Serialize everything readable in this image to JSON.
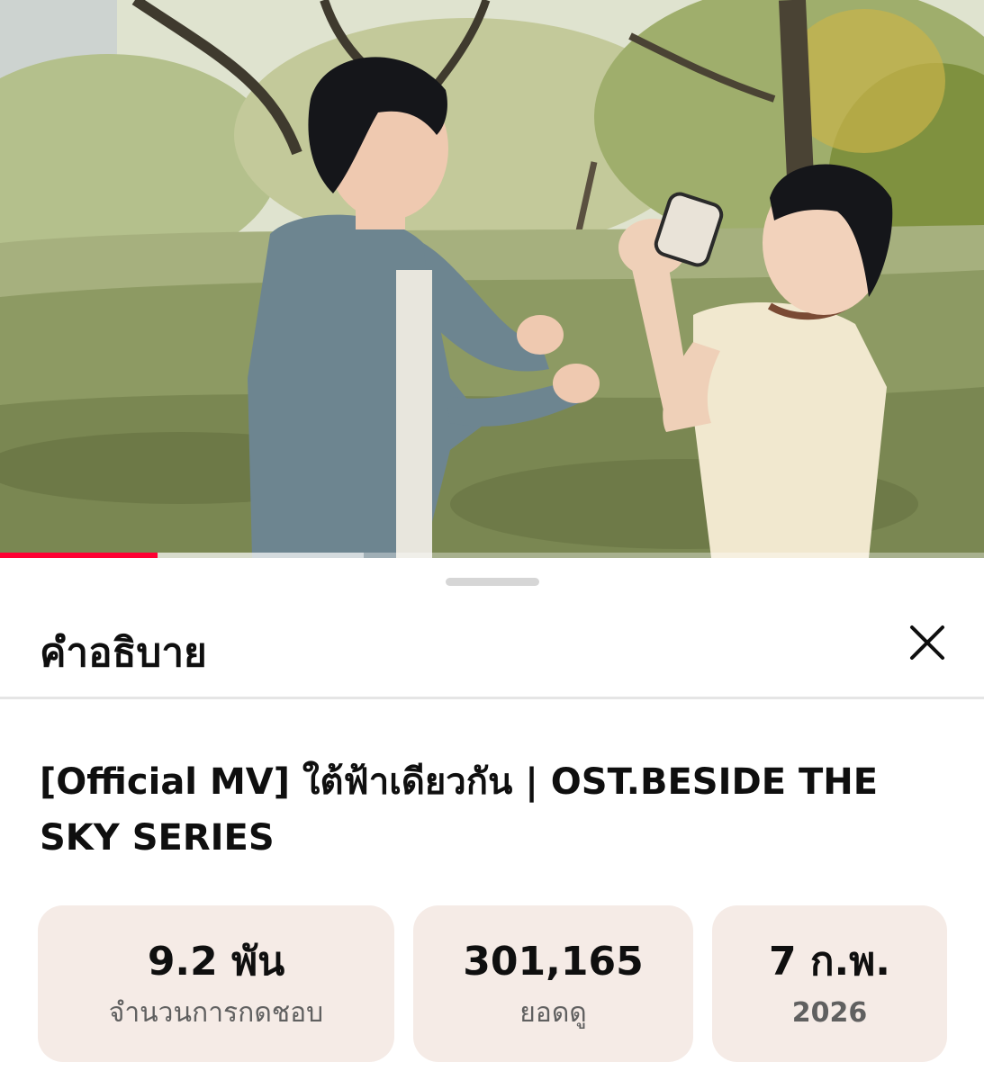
{
  "video": {
    "description_frame": "music-video-frame",
    "progress_percent": 16,
    "buffer_percent": 37,
    "progress_color": "#ff0033"
  },
  "sheet": {
    "title": "คำอธิบาย",
    "close_icon": "close-icon"
  },
  "video_title": "[Official MV] ใต้ฟ้าเดียวกัน | OST.BESIDE THE SKY SERIES",
  "stats": [
    {
      "value": "9.2 พัน",
      "label": "จำนวนการกดชอบ"
    },
    {
      "value": "301,165",
      "label": "ยอดดู"
    },
    {
      "value": "7 ก.พ.",
      "label": "2026"
    }
  ],
  "colors": {
    "stat_background": "#f5ebe6",
    "text_primary": "#0f0f0f",
    "text_secondary": "#606060"
  }
}
